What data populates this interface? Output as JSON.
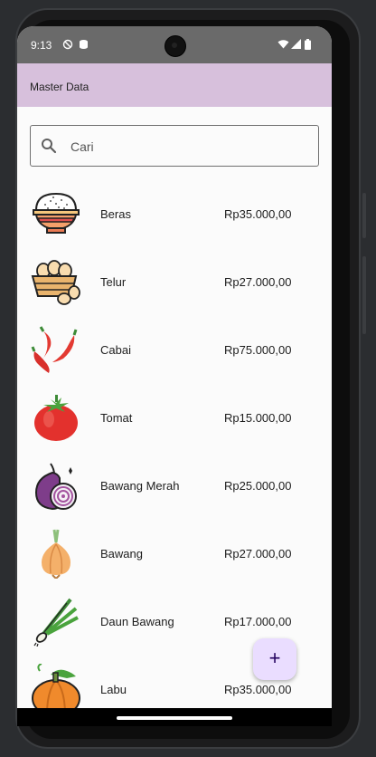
{
  "status_bar": {
    "time": "9:13"
  },
  "app_bar": {
    "title": "Master Data"
  },
  "search": {
    "placeholder": "Cari"
  },
  "items": [
    {
      "name": "Beras",
      "price": "Rp35.000,00",
      "icon": "rice-bowl-icon"
    },
    {
      "name": "Telur",
      "price": "Rp27.000,00",
      "icon": "eggs-basket-icon"
    },
    {
      "name": "Cabai",
      "price": "Rp75.000,00",
      "icon": "chili-icon"
    },
    {
      "name": "Tomat",
      "price": "Rp15.000,00",
      "icon": "tomato-icon"
    },
    {
      "name": "Bawang Merah",
      "price": "Rp25.000,00",
      "icon": "red-onion-icon"
    },
    {
      "name": "Bawang",
      "price": "Rp27.000,00",
      "icon": "onion-icon"
    },
    {
      "name": "Daun Bawang",
      "price": "Rp17.000,00",
      "icon": "scallion-icon"
    },
    {
      "name": "Labu",
      "price": "Rp35.000,00",
      "icon": "pumpkin-icon"
    }
  ],
  "fab": {
    "label": "+"
  },
  "colors": {
    "app_bar": "#d7c0dc",
    "fab": "#eaddff",
    "status_bar": "#6a6a6a"
  }
}
